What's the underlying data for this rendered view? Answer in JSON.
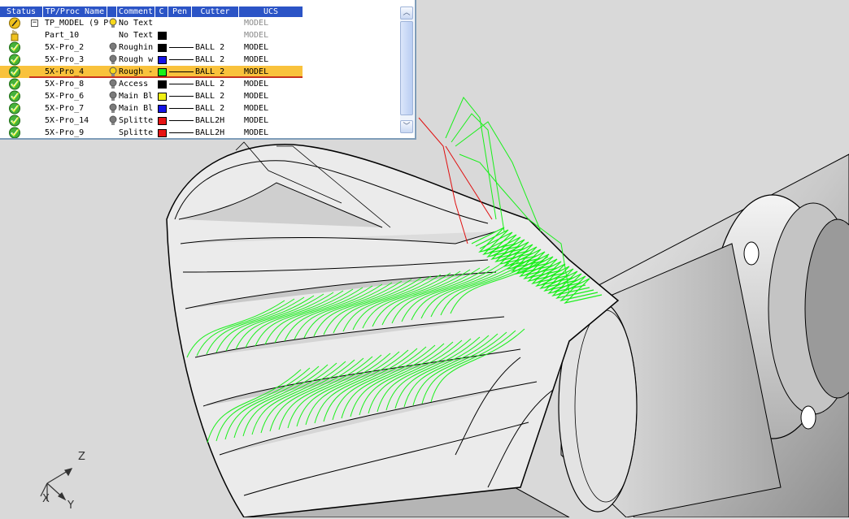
{
  "viewport": {
    "background": "#d9d9d9",
    "toolpath_color": "#19f01a",
    "link_color": "#e01010"
  },
  "tree": {
    "columns": [
      "Status",
      "TP/Proc Name",
      "",
      "Comment",
      "C",
      "Pen",
      "Cutter",
      "UCS"
    ],
    "rows": [
      {
        "status": "pencil-icon",
        "name": "TP_MODEL (9 P",
        "bulb": "bulb-on",
        "comment": "No Text",
        "color": "",
        "pen": false,
        "cutter": "",
        "ucs": "MODEL",
        "selected": false,
        "root": true
      },
      {
        "status": "hand-icon",
        "name": "Part_10",
        "bulb": "",
        "comment": "No Text",
        "color": "#000000",
        "pen": false,
        "cutter": "",
        "ucs": "MODEL",
        "selected": false
      },
      {
        "status": "check-icon",
        "name": "5X-Pro_2",
        "bulb": "bulb-off",
        "comment": "Roughin",
        "color": "#000000",
        "pen": true,
        "cutter": "BALL 2",
        "ucs": "MODEL",
        "selected": false
      },
      {
        "status": "check-icon",
        "name": "5X-Pro_3",
        "bulb": "bulb-off",
        "comment": "Rough w",
        "color": "#1414e6",
        "pen": true,
        "cutter": "BALL 2",
        "ucs": "MODEL",
        "selected": false
      },
      {
        "status": "check-icon",
        "name": "5X-Pro_4",
        "bulb": "bulb-on",
        "comment": "Rough -",
        "color": "#19f01a",
        "pen": true,
        "cutter": "BALL 2",
        "ucs": "MODEL",
        "selected": true
      },
      {
        "status": "check-icon",
        "name": "5X-Pro_8",
        "bulb": "bulb-off",
        "comment": "Access",
        "color": "#000000",
        "pen": true,
        "cutter": "BALL 2",
        "ucs": "MODEL",
        "selected": false
      },
      {
        "status": "check-icon",
        "name": "5X-Pro_6",
        "bulb": "bulb-off",
        "comment": "Main Bl",
        "color": "#f0f014",
        "pen": true,
        "cutter": "BALL 2",
        "ucs": "MODEL",
        "selected": false
      },
      {
        "status": "check-icon",
        "name": "5X-Pro_7",
        "bulb": "bulb-off",
        "comment": "Main Bl",
        "color": "#1414e6",
        "pen": true,
        "cutter": "BALL 2",
        "ucs": "MODEL",
        "selected": false
      },
      {
        "status": "check-icon",
        "name": "5X-Pro_14",
        "bulb": "bulb-off",
        "comment": "Splitte",
        "color": "#e61414",
        "pen": true,
        "cutter": "BALL2H",
        "ucs": "MODEL",
        "selected": false
      },
      {
        "status": "check-icon",
        "name": "5X-Pro_9",
        "bulb": "",
        "comment": "Splitte",
        "color": "#e61414",
        "pen": true,
        "cutter": "BALL2H",
        "ucs": "MODEL",
        "selected": false
      }
    ]
  },
  "axes": {
    "z": "Z",
    "x": "X",
    "y": "Y"
  }
}
